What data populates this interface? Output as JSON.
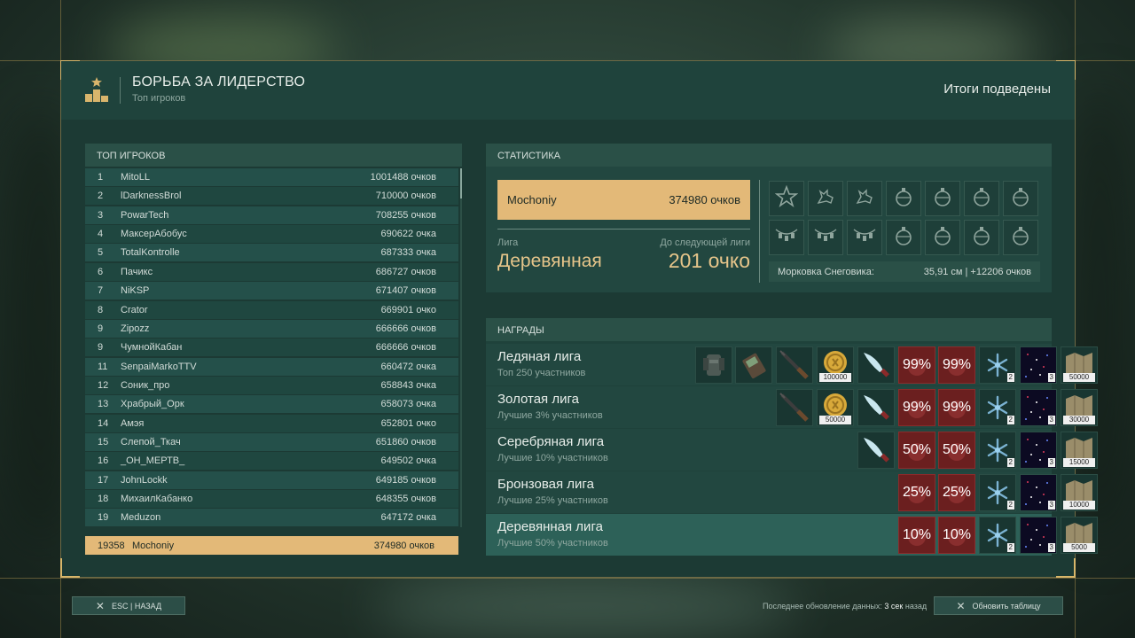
{
  "header": {
    "title": "БОРЬБА ЗА ЛИДЕРСТВО",
    "subtitle": "Топ игроков",
    "status": "Итоги подведены"
  },
  "top_players": {
    "title": "ТОП ИГРОКОВ",
    "rows": [
      {
        "rank": "1",
        "name": "MitoLL",
        "score": "1001488 очков"
      },
      {
        "rank": "2",
        "name": "lDarknessBrol",
        "score": "710000 очков"
      },
      {
        "rank": "3",
        "name": "PowarTech",
        "score": "708255 очков"
      },
      {
        "rank": "4",
        "name": "МаксерАбобус",
        "score": "690622 очка"
      },
      {
        "rank": "5",
        "name": "TotalKontrolle",
        "score": "687333 очка"
      },
      {
        "rank": "6",
        "name": "Пачикс",
        "score": "686727 очков"
      },
      {
        "rank": "7",
        "name": "NiKSP",
        "score": "671407 очков"
      },
      {
        "rank": "8",
        "name": "Crator",
        "score": "669901 очко"
      },
      {
        "rank": "9",
        "name": "Zipozz",
        "score": "666666 очков"
      },
      {
        "rank": "9",
        "name": "ЧумнойКабан",
        "score": "666666 очков"
      },
      {
        "rank": "11",
        "name": "SenpaiMarkoTTV",
        "score": "660472 очка"
      },
      {
        "rank": "12",
        "name": "Соник_про",
        "score": "658843 очка"
      },
      {
        "rank": "13",
        "name": "Храбрый_Орк",
        "score": "658073 очка"
      },
      {
        "rank": "14",
        "name": "Амэя",
        "score": "652801 очко"
      },
      {
        "rank": "15",
        "name": "Слепой_Ткач",
        "score": "651860 очков"
      },
      {
        "rank": "16",
        "name": "_ОН_МЕРТВ_",
        "score": "649502 очка"
      },
      {
        "rank": "17",
        "name": "JohnLockk",
        "score": "649185 очков"
      },
      {
        "rank": "18",
        "name": "МихаилКабанко",
        "score": "648355 очков"
      },
      {
        "rank": "19",
        "name": "Meduzon",
        "score": "647172 очка"
      }
    ],
    "self": {
      "rank": "19358",
      "name": "Mochoniy",
      "score": "374980 очков"
    }
  },
  "stats": {
    "title": "СТАТИСТИКА",
    "player_name": "Mochoniy",
    "player_score": "374980 очков",
    "league_label": "Лига",
    "league_value": "Деревянная",
    "next_label": "До следующей лиги",
    "next_value": "201 очко",
    "achievements": [
      "star-icon",
      "dog-icon",
      "dog-icon",
      "ornament-icon",
      "ornament-icon",
      "ornament-icon",
      "ornament-icon",
      "garland-icon",
      "garland-icon",
      "garland-icon",
      "ornament-icon",
      "ornament-icon",
      "ornament-icon",
      "ornament-icon"
    ],
    "carrot_label": "Морковка Снеговика:",
    "carrot_value": "35,91 см",
    "carrot_sep": "|",
    "carrot_bonus": "+12206 очков"
  },
  "rewards": {
    "title": "НАГРАДЫ",
    "leagues": [
      {
        "name": "Ледяная лига",
        "desc": "Топ 250 участников",
        "armor": true,
        "radio": true,
        "rifle": true,
        "coin": "100000",
        "knife": true,
        "pct1": "99%",
        "pct2": "99%",
        "snowflake": "2",
        "space": "3",
        "map": "50000"
      },
      {
        "name": "Золотая лига",
        "desc": "Лучшие 3% участников",
        "rifle": true,
        "coin": "50000",
        "knife": true,
        "pct1": "99%",
        "pct2": "99%",
        "snowflake": "2",
        "space": "3",
        "map": "30000"
      },
      {
        "name": "Серебряная лига",
        "desc": "Лучшие 10% участников",
        "knife": true,
        "pct1": "50%",
        "pct2": "50%",
        "snowflake": "2",
        "space": "3",
        "map": "15000"
      },
      {
        "name": "Бронзовая лига",
        "desc": "Лучшие 25% участников",
        "pct1": "25%",
        "pct2": "25%",
        "snowflake": "2",
        "space": "3",
        "map": "10000"
      },
      {
        "name": "Деревянная лига",
        "desc": "Лучшие 50% участников",
        "pct1": "10%",
        "pct2": "10%",
        "snowflake": "2",
        "space": "3",
        "map": "5000"
      }
    ]
  },
  "footer": {
    "back_label": "ESC | НАЗАД",
    "update_prefix": "Последнее обновление данных:",
    "update_value": "3 сек",
    "update_suffix": "назад",
    "refresh_label": "Обновить таблицу"
  }
}
